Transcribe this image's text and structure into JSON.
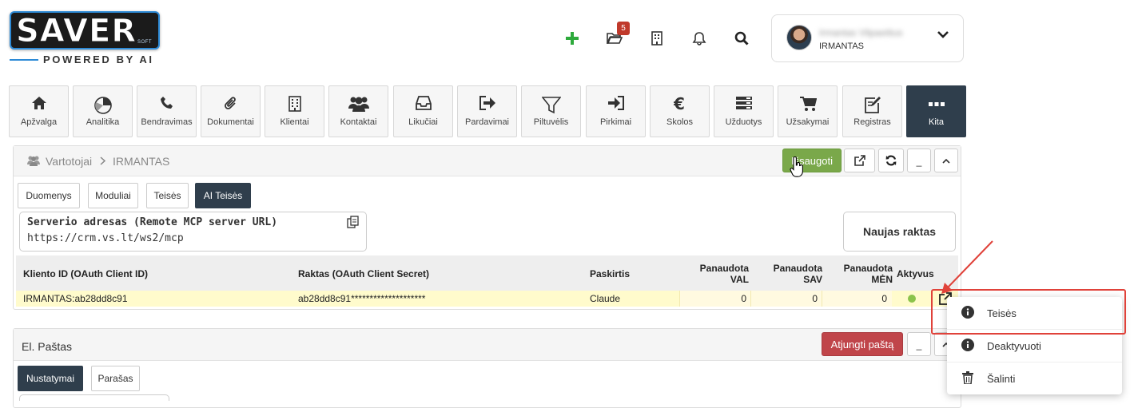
{
  "logo": {
    "text": "SAVER",
    "suffix": "SOFT",
    "tagline": "POWERED BY AI"
  },
  "header": {
    "notification_badge": "5",
    "icons": [
      "add-icon",
      "folder-open-icon",
      "building-icon",
      "bell-icon",
      "search-icon"
    ]
  },
  "user": {
    "name": "Irmantas Vilpaeitius",
    "login": "IRMANTAS"
  },
  "nav": [
    {
      "label": "Apžvalga",
      "icon": "home-icon"
    },
    {
      "label": "Analitika",
      "icon": "pie-chart-icon"
    },
    {
      "label": "Bendravimas",
      "icon": "phone-icon"
    },
    {
      "label": "Dokumentai",
      "icon": "paperclip-icon"
    },
    {
      "label": "Klientai",
      "icon": "building-icon"
    },
    {
      "label": "Kontaktai",
      "icon": "users-icon"
    },
    {
      "label": "Likučiai",
      "icon": "inbox-icon"
    },
    {
      "label": "Pardavimai",
      "icon": "sign-out-icon"
    },
    {
      "label": "Piltuvėlis",
      "icon": "funnel-icon"
    },
    {
      "label": "Pirkimai",
      "icon": "sign-in-icon"
    },
    {
      "label": "Skolos",
      "icon": "euro-icon"
    },
    {
      "label": "Užduotys",
      "icon": "tasks-icon"
    },
    {
      "label": "Užsakymai",
      "icon": "cart-icon"
    },
    {
      "label": "Registras",
      "icon": "edit-icon"
    },
    {
      "label": "Kita",
      "icon": "more-icon"
    }
  ],
  "panel1": {
    "breadcrumb_root": "Vartotojai",
    "breadcrumb_sep": ">",
    "breadcrumb_current": "IRMANTAS",
    "save_label": "Išsaugoti",
    "minimize_label": "_",
    "tabs": [
      "Duomenys",
      "Moduliai",
      "Teisės",
      "AI Teisės"
    ],
    "server_label": "Serverio adresas (Remote MCP server URL)",
    "server_value": "https://crm.vs.lt/ws2/mcp",
    "new_key_label": "Naujas raktas",
    "table": {
      "headers": {
        "client_id": "Kliento ID (OAuth Client ID)",
        "secret": "Raktas (OAuth Client Secret)",
        "purpose": "Paskirtis",
        "used_val_1": "Panaudota",
        "used_val_2": "VAL",
        "used_sav_1": "Panaudota",
        "used_sav_2": "SAV",
        "used_men_1": "Panaudota",
        "used_men_2": "MĖN",
        "active": "Aktyvus"
      },
      "rows": [
        {
          "client_id": "IRMANTAS:ab28dd8c91",
          "secret": "ab28dd8c91********************",
          "purpose": "Claude",
          "used_val": "0",
          "used_sav": "0",
          "used_men": "0",
          "active": true
        }
      ]
    }
  },
  "panel2": {
    "title": "El. Paštas",
    "disconnect_label": "Atjungti paštą",
    "minimize_label": "_",
    "tabs": [
      "Nustatymai",
      "Parašas"
    ]
  },
  "dropdown": {
    "items": [
      {
        "label": "Teisės",
        "icon": "info-circle-icon"
      },
      {
        "label": "Deaktyvuoti",
        "icon": "info-circle-icon"
      },
      {
        "label": "Šalinti",
        "icon": "trash-icon"
      }
    ]
  },
  "colors": {
    "accent_dark": "#2f3e4c",
    "save_green": "#7aa84a",
    "danger_red": "#c0454a",
    "highlight_row": "#fffbcc",
    "annotation_red": "#e0423a",
    "add_green": "#2eaa3c"
  }
}
